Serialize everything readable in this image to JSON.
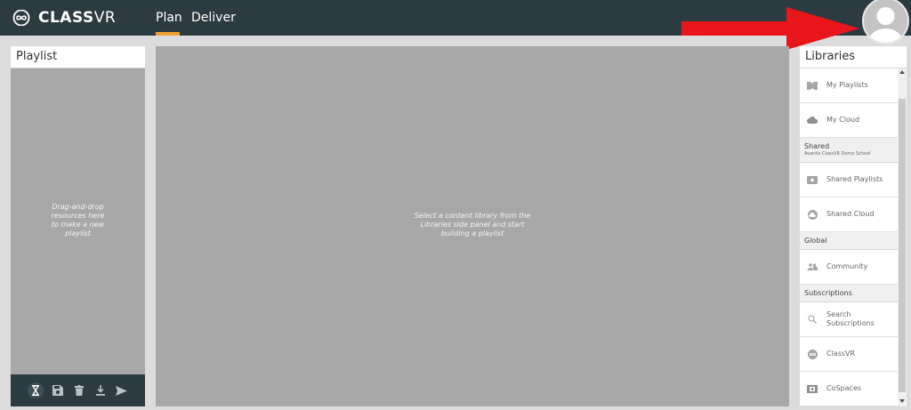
{
  "app": {
    "logo_bold": "CLASS",
    "logo_light": "VR"
  },
  "nav": {
    "plan": "Plan",
    "deliver": "Deliver",
    "active": "Plan",
    "accent_color": "#f0a030"
  },
  "header": {
    "arrow_color": "#e8151b",
    "avatar_icon": "user-avatar-icon"
  },
  "playlist": {
    "title": "Playlist",
    "hint": "Drag-and-drop\nresources here\nto make a new\nplaylist",
    "toolbar": [
      {
        "icon": "hourglass-icon"
      },
      {
        "icon": "save-icon"
      },
      {
        "icon": "trash-icon"
      },
      {
        "icon": "download-icon"
      },
      {
        "icon": "send-icon"
      }
    ]
  },
  "main": {
    "hint": "Select a content library from the\nLibraries side panel and start\nbuilding a playlist"
  },
  "libraries": {
    "title": "Libraries",
    "my_playlists": "My Playlists",
    "my_cloud": "My Cloud",
    "shared_section": "Shared",
    "shared_org": "Avantis ClassVR Demo School",
    "shared_playlists": "Shared Playlists",
    "shared_cloud": "Shared Cloud",
    "global_section": "Global",
    "community": "Community",
    "subscriptions_section": "Subscriptions",
    "search_subscriptions": "Search\nSubscriptions",
    "classvr": "ClassVR",
    "cospaces": "CoSpaces"
  },
  "colors": {
    "topbar": "#2c3b41",
    "panel_bg": "#a8a8a8",
    "page_bg": "#dcdcdc"
  }
}
